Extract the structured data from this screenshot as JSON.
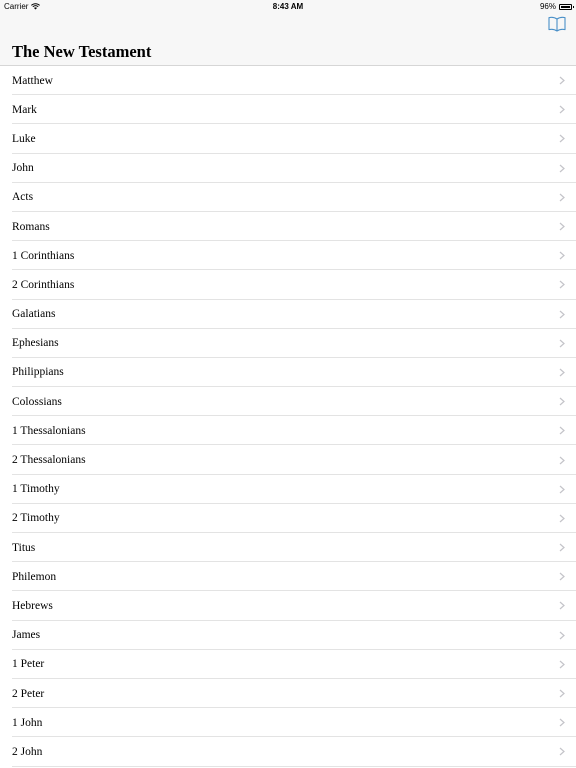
{
  "status_bar": {
    "carrier": "Carrier",
    "time": "8:43 AM",
    "battery": "96%",
    "battery_level": 0.96
  },
  "nav": {
    "title": "The New Testament",
    "right_icon": "book-icon",
    "accent_color": "#4a90c8"
  },
  "books": [
    {
      "label": "Matthew"
    },
    {
      "label": "Mark"
    },
    {
      "label": "Luke"
    },
    {
      "label": "John"
    },
    {
      "label": "Acts"
    },
    {
      "label": "Romans"
    },
    {
      "label": "1 Corinthians"
    },
    {
      "label": "2 Corinthians"
    },
    {
      "label": "Galatians"
    },
    {
      "label": "Ephesians"
    },
    {
      "label": "Philippians"
    },
    {
      "label": "Colossians"
    },
    {
      "label": "1 Thessalonians"
    },
    {
      "label": "2 Thessalonians"
    },
    {
      "label": "1 Timothy"
    },
    {
      "label": "2 Timothy"
    },
    {
      "label": "Titus"
    },
    {
      "label": "Philemon"
    },
    {
      "label": "Hebrews"
    },
    {
      "label": "James"
    },
    {
      "label": "1 Peter"
    },
    {
      "label": "2 Peter"
    },
    {
      "label": "1 John"
    },
    {
      "label": "2 John"
    }
  ]
}
